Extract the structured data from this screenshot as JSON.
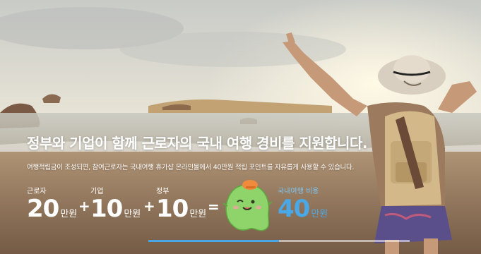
{
  "banner": {
    "headline": "정부와 기업이 함께 근로자의 국내 여행 경비를 지원합니다.",
    "subline": "여행적립금이 조성되면, 참여근로자는 국내여행 휴가샵 온라인몰에서 40만원 적립 포인트를 자유롭게 사용할 수 있습니다.",
    "terms": [
      {
        "label": "근로자",
        "value": "20",
        "unit": "만원"
      },
      {
        "label": "기업",
        "value": "10",
        "unit": "만원"
      },
      {
        "label": "정부",
        "value": "10",
        "unit": "만원"
      }
    ],
    "plus": "+",
    "equals": "=",
    "result": {
      "label": "국내여행 비용",
      "value": "40",
      "unit": "만원"
    },
    "mascot_icon": "green-ghost-mascot-icon",
    "slide_progress": 0.5,
    "colors": {
      "accent": "#4aa8e6",
      "mascot": "#8fd36b",
      "text": "#ffffff"
    }
  }
}
